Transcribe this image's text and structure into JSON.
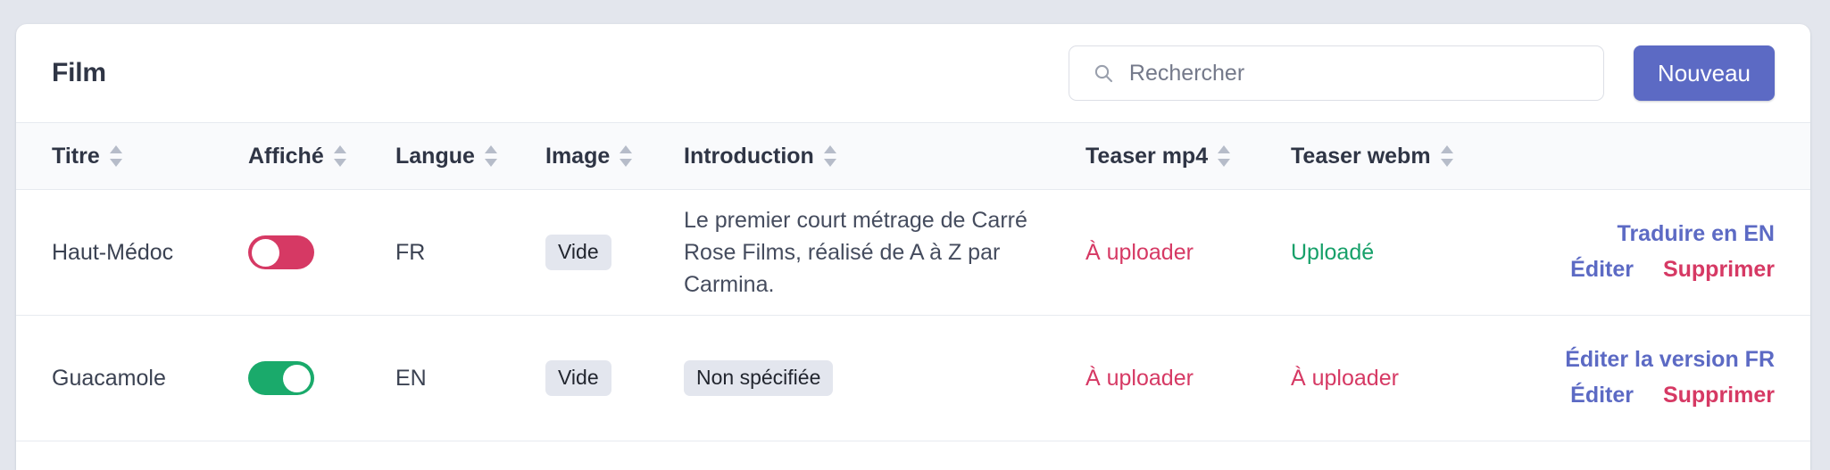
{
  "page": {
    "title": "Film",
    "background_color": "#e3e6ed",
    "accent_color": "#5c6ac4",
    "danger_color": "#d63964",
    "success_color": "#16a069"
  },
  "toolbar": {
    "search": {
      "placeholder": "Rechercher",
      "value": "",
      "icon": "search-icon"
    },
    "new_button_label": "Nouveau"
  },
  "table": {
    "columns": [
      {
        "label": "Titre",
        "sortable": true,
        "sort_icon": "sort-updown-icon"
      },
      {
        "label": "Affiché",
        "sortable": true,
        "sort_icon": "sort-updown-icon"
      },
      {
        "label": "Langue",
        "sortable": true,
        "sort_icon": "sort-updown-icon"
      },
      {
        "label": "Image",
        "sortable": true,
        "sort_icon": "sort-updown-icon"
      },
      {
        "label": "Introduction",
        "sortable": true,
        "sort_icon": "sort-updown-icon"
      },
      {
        "label": "Teaser mp4",
        "sortable": true,
        "sort_icon": "sort-updown-icon"
      },
      {
        "label": "Teaser webm",
        "sortable": true,
        "sort_icon": "sort-updown-icon"
      },
      {
        "label": "",
        "sortable": false,
        "sort_icon": ""
      }
    ],
    "rows": [
      {
        "titre": "Haut-Médoc",
        "affiche": {
          "state": "off",
          "color": "#d63964"
        },
        "langue": "FR",
        "image": "Vide",
        "introduction": "Le premier court métrage de Carré Rose Films, réalisé de A à Z par Carmina.",
        "introduction_badge": "",
        "teaser_mp4": "À uploader",
        "teaser_mp4_status": "todo",
        "teaser_webm": "Uploadé",
        "teaser_webm_status": "uploaded",
        "actions": {
          "translate": "Traduire en EN",
          "edit": "Éditer",
          "delete": "Supprimer"
        }
      },
      {
        "titre": "Guacamole",
        "affiche": {
          "state": "on",
          "color": "#1aaa6b"
        },
        "langue": "EN",
        "image": "Vide",
        "introduction": "",
        "introduction_badge": "Non spécifiée",
        "teaser_mp4": "À uploader",
        "teaser_mp4_status": "todo",
        "teaser_webm": "À uploader",
        "teaser_webm_status": "todo",
        "actions": {
          "translate": "Éditer la version FR",
          "edit": "Éditer",
          "delete": "Supprimer"
        }
      }
    ]
  }
}
